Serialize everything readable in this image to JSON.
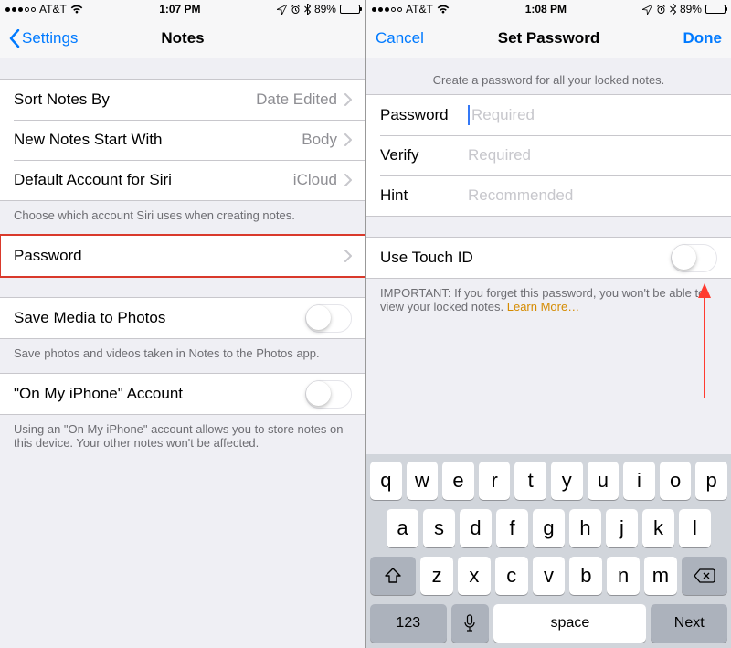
{
  "left": {
    "status": {
      "carrier": "AT&T",
      "time": "1:07 PM",
      "battery": "89%"
    },
    "nav": {
      "back": "Settings",
      "title": "Notes"
    },
    "rows": {
      "sort": {
        "label": "Sort Notes By",
        "value": "Date Edited"
      },
      "newNotes": {
        "label": "New Notes Start With",
        "value": "Body"
      },
      "siriAccount": {
        "label": "Default Account for Siri",
        "value": "iCloud"
      },
      "password": {
        "label": "Password"
      },
      "saveMedia": {
        "label": "Save Media to Photos"
      },
      "onMyiPhone": {
        "label": "\"On My iPhone\" Account"
      }
    },
    "footers": {
      "siri": "Choose which account Siri uses when creating notes.",
      "saveMedia": "Save photos and videos taken in Notes to the Photos app.",
      "onMyiPhone": "Using an \"On My iPhone\" account allows you to store notes on this device. Your other notes won't be affected."
    }
  },
  "right": {
    "status": {
      "carrier": "AT&T",
      "time": "1:08 PM",
      "battery": "89%"
    },
    "nav": {
      "cancel": "Cancel",
      "title": "Set Password",
      "done": "Done"
    },
    "header": "Create a password for all your locked notes.",
    "fields": {
      "password": {
        "label": "Password",
        "placeholder": "Required"
      },
      "verify": {
        "label": "Verify",
        "placeholder": "Required"
      },
      "hint": {
        "label": "Hint",
        "placeholder": "Recommended"
      }
    },
    "touchId": {
      "label": "Use Touch ID"
    },
    "important": {
      "text": "IMPORTANT: If you forget this password, you won't be able to view your locked notes. ",
      "learnMore": "Learn More…"
    },
    "keyboard": {
      "row1": [
        "q",
        "w",
        "e",
        "r",
        "t",
        "y",
        "u",
        "i",
        "o",
        "p"
      ],
      "row2": [
        "a",
        "s",
        "d",
        "f",
        "g",
        "h",
        "j",
        "k",
        "l"
      ],
      "row3": [
        "z",
        "x",
        "c",
        "v",
        "b",
        "n",
        "m"
      ],
      "num": "123",
      "space": "space",
      "next": "Next"
    }
  }
}
